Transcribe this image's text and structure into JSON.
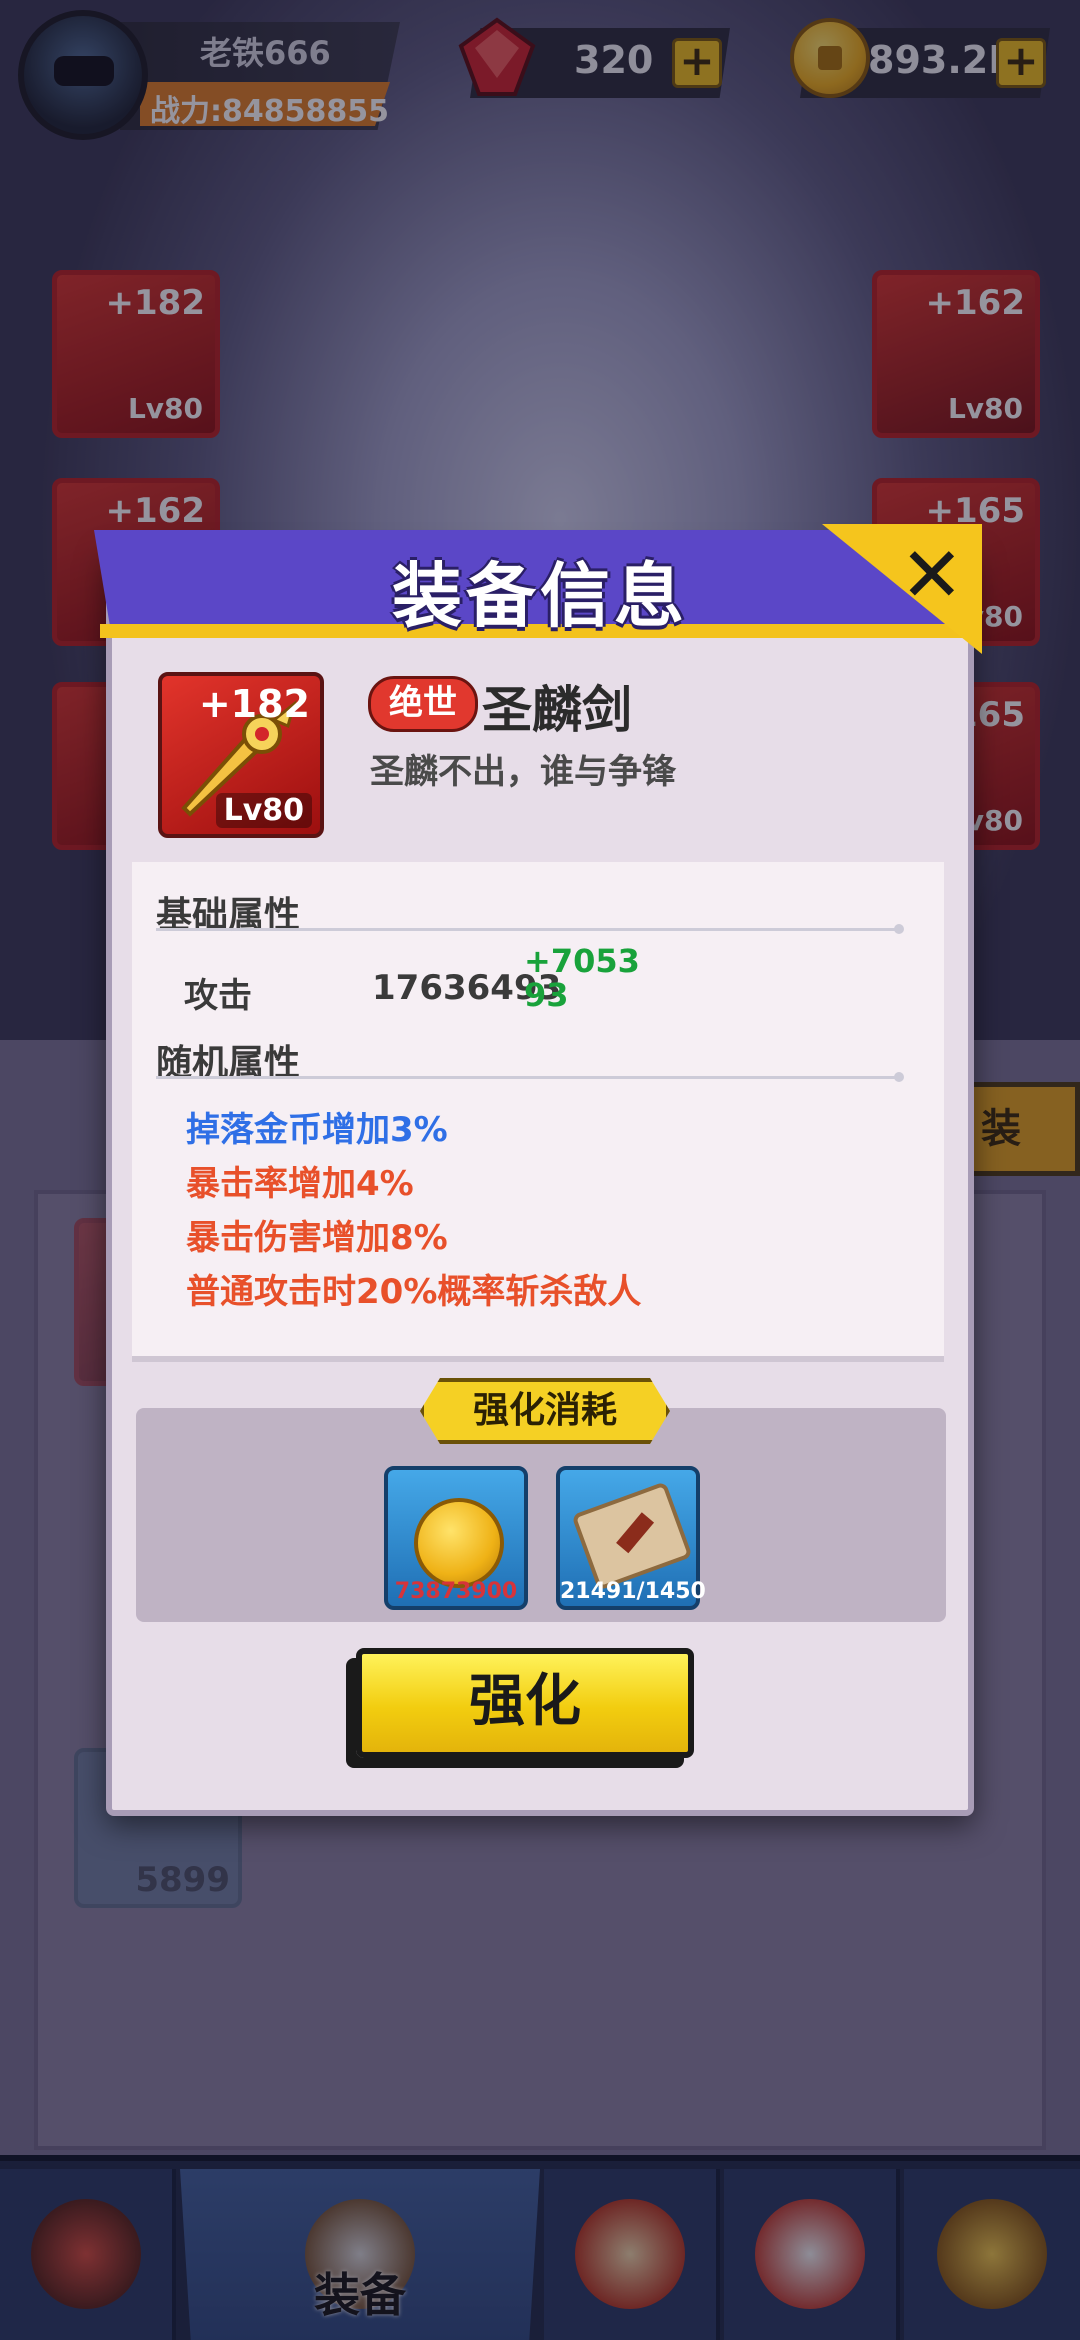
{
  "player": {
    "name": "老铁666",
    "power_text": "战力:84858855"
  },
  "resources": {
    "gems": "320",
    "gold": "893.2K",
    "plus": "+"
  },
  "slots": [
    {
      "plus": "+182",
      "lv": "Lv80"
    },
    {
      "plus": "+162",
      "lv": "Lv80"
    },
    {
      "plus": "+162",
      "lv": ""
    },
    {
      "plus": "+165",
      "lv": "v80"
    },
    {
      "plus": "165",
      "lv": "v80"
    }
  ],
  "side_button": "装",
  "bag_count": "5899",
  "nav": {
    "active_label": "装备"
  },
  "modal": {
    "title": "装备信息",
    "close": "✕",
    "item": {
      "plus": "+182",
      "lv": "Lv80",
      "rarity": "绝世",
      "name": "圣麟剑",
      "desc": "圣麟不出，谁与争锋"
    },
    "base_section": "基础属性",
    "base_attr": {
      "label": "攻击",
      "value": "17636493",
      "bonus": "+705393"
    },
    "random_section": "随机属性",
    "random_attrs": [
      {
        "text": "掉落金币增加3%",
        "color": "#2f6fe6"
      },
      {
        "text": "暴击率增加4%",
        "color": "#e8502a"
      },
      {
        "text": "暴击伤害增加8%",
        "color": "#e8502a"
      },
      {
        "text": "普通攻击时20%概率斩杀敌人",
        "color": "#e8502a"
      }
    ],
    "cost_title": "强化消耗",
    "costs": [
      {
        "icon": "coins-icon",
        "count": "73873900",
        "color": "#d6343a"
      },
      {
        "icon": "scroll-icon",
        "count": "21491/1450",
        "color": "#ffffff"
      }
    ],
    "upgrade_label": "强化"
  }
}
